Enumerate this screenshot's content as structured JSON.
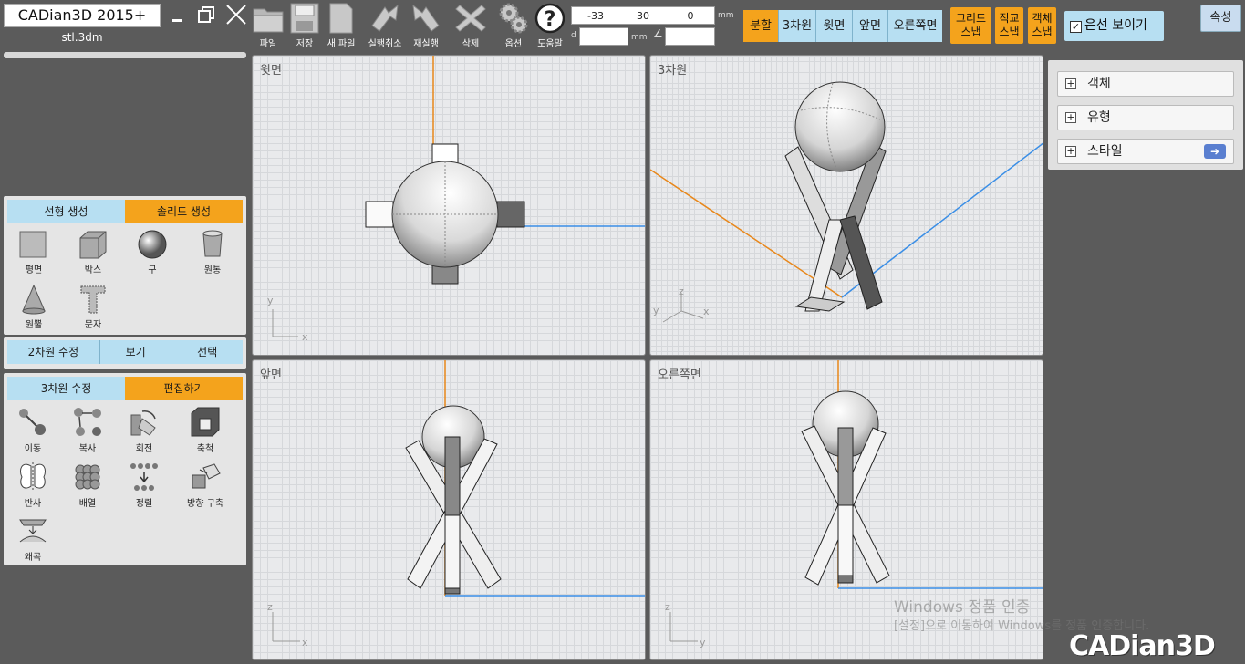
{
  "app": {
    "title": "CADian3D 2015+",
    "file_name": "stl.3dm",
    "brand_logo": "CADian3D"
  },
  "toolbar": {
    "items": [
      {
        "label": "파일",
        "icon": "folder-icon"
      },
      {
        "label": "저장",
        "icon": "save-icon"
      },
      {
        "label": "새 파일",
        "icon": "new-file-icon"
      },
      {
        "label": "실행취소",
        "icon": "undo-icon"
      },
      {
        "label": "재실행",
        "icon": "redo-icon"
      },
      {
        "label": "삭제",
        "icon": "delete-icon"
      },
      {
        "label": "옵션",
        "icon": "gear-icon"
      },
      {
        "label": "도움말",
        "icon": "help-icon"
      }
    ],
    "coords": {
      "x": "-33",
      "y": "30",
      "z": "0",
      "unit": "mm",
      "dist_label": "d",
      "dist_unit": "mm",
      "angle_label": "∠"
    }
  },
  "views": {
    "buttons": [
      {
        "label": "분할",
        "active": true
      },
      {
        "label": "3차원",
        "active": false
      },
      {
        "label": "윗면",
        "active": false
      },
      {
        "label": "앞면",
        "active": false
      },
      {
        "label": "오른쪽면",
        "active": false
      }
    ]
  },
  "snaps": [
    {
      "line1": "그리드",
      "line2": "스냅"
    },
    {
      "line1": "직교",
      "line2": "스냅"
    },
    {
      "line1": "객체",
      "line2": "스냅"
    }
  ],
  "hidden_line": {
    "label": "은선 보이기",
    "checked": true
  },
  "properties_label": "속성",
  "panel_create": {
    "tabs": [
      {
        "label": "선형 생성",
        "active": false
      },
      {
        "label": "솔리드 생성",
        "active": true
      }
    ],
    "items": [
      {
        "label": "평면"
      },
      {
        "label": "박스"
      },
      {
        "label": "구"
      },
      {
        "label": "원통"
      },
      {
        "label": "원뿔"
      },
      {
        "label": "문자"
      }
    ]
  },
  "panel_2d": {
    "tabs": [
      {
        "label": "2차원 수정"
      },
      {
        "label": "보기"
      },
      {
        "label": "선택"
      }
    ]
  },
  "panel_edit": {
    "tabs": [
      {
        "label": "3차원 수정",
        "active": false
      },
      {
        "label": "편집하기",
        "active": true
      }
    ],
    "items": [
      {
        "label": "이동"
      },
      {
        "label": "복사"
      },
      {
        "label": "회전"
      },
      {
        "label": "축척"
      },
      {
        "label": "반사"
      },
      {
        "label": "배열"
      },
      {
        "label": "정렬"
      },
      {
        "label": "방향 구축"
      },
      {
        "label": "왜곡"
      }
    ]
  },
  "viewports": {
    "top": {
      "label": "윗면",
      "axis1": "y",
      "axis2": "x"
    },
    "perspective": {
      "label": "3차원",
      "axis1": "z",
      "axis2": "y",
      "axis3": "x"
    },
    "front": {
      "label": "앞면",
      "axis1": "z",
      "axis2": "x"
    },
    "right": {
      "label": "오른쪽면",
      "axis1": "z",
      "axis2": "y"
    }
  },
  "right_panel": {
    "items": [
      {
        "label": "객체"
      },
      {
        "label": "유형"
      },
      {
        "label": "스타일"
      }
    ]
  },
  "watermark": {
    "line1": "Windows 정품 인증",
    "line2": "[설정]으로 이동하여 Windows를 정품 인증합니다."
  },
  "colors": {
    "accent_orange": "#f4a31c",
    "accent_blue": "#b7dff2",
    "axis_x": "#3a8ee6",
    "axis_y": "#e8871a"
  }
}
